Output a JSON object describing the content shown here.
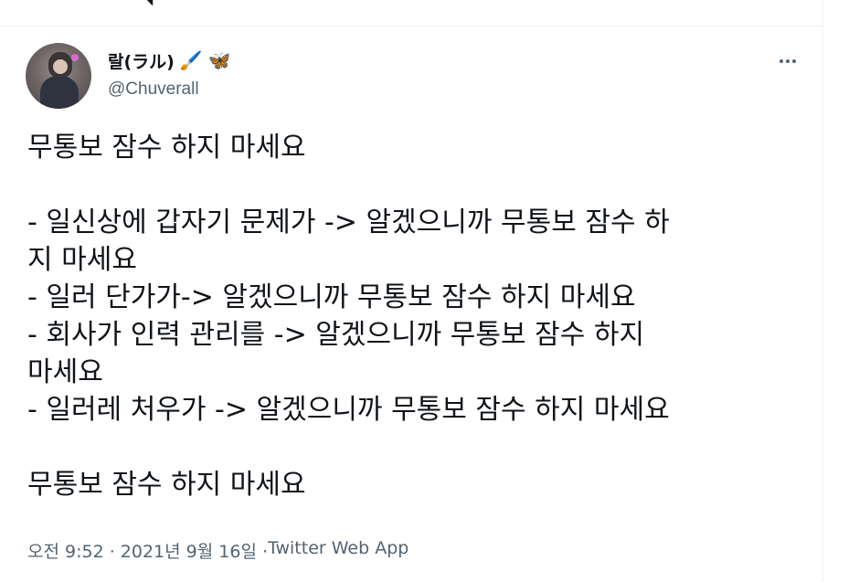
{
  "tweet": {
    "author": {
      "display_name": "랄(ラル)",
      "emojis": [
        "🖌️",
        "🦋"
      ],
      "handle": "@Chuverall",
      "avatar_icon": "avatar-photo"
    },
    "more_icon": "more-horizontal-icon",
    "body_lines": [
      "무통보 잠수 하지 마세요",
      "",
      "- 일신상에 갑자기 문제가 -> 알겠으니까 무통보 잠수 하",
      "지 마세요",
      "- 일러 단가가-> 알겠으니까 무통보 잠수 하지 마세요",
      "- 회사가 인력 관리를 -> 알겠으니까 무통보 잠수 하지",
      "마세요",
      "- 일러레 처우가 -> 알겠으니까 무통보 잠수 하지 마세요",
      "",
      "무통보 잠수 하지 마세요"
    ],
    "timestamp": "오전 9:52 · 2021년 9월 16일 · ",
    "source": "Twitter Web App"
  },
  "colors": {
    "text_primary": "#0f1419",
    "text_secondary": "#536471",
    "border": "#eff3f4"
  }
}
